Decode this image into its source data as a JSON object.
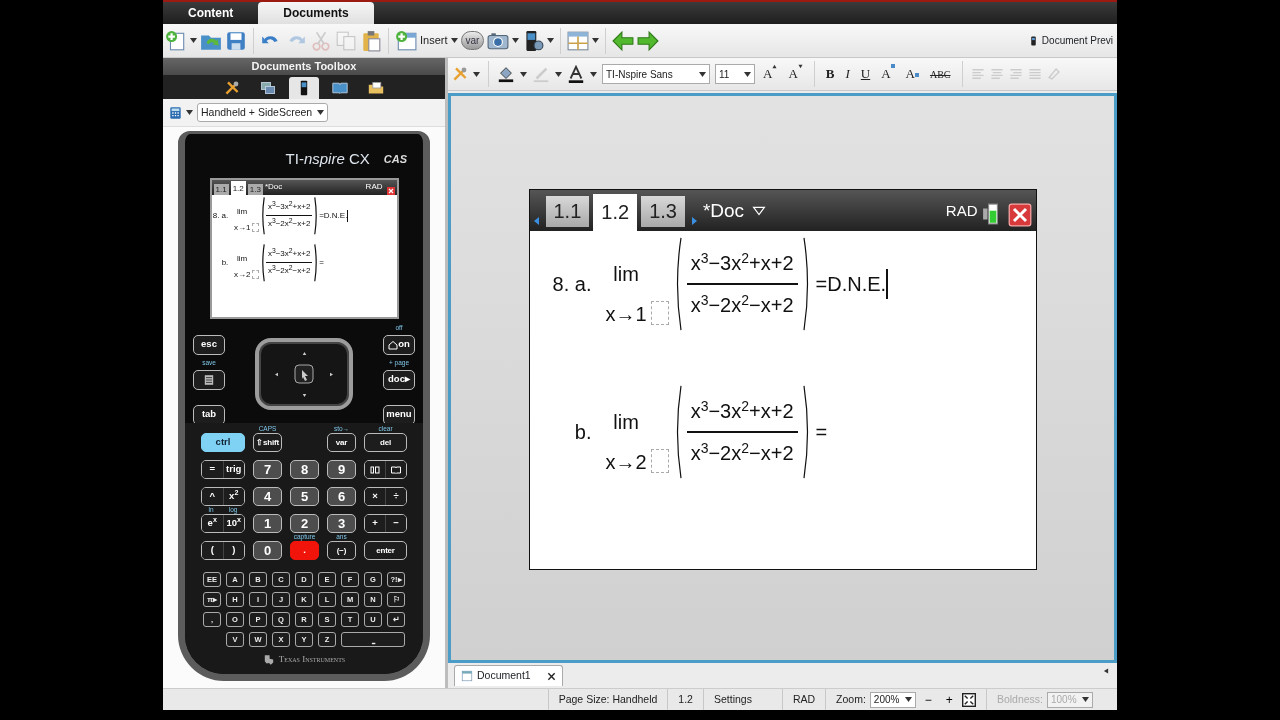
{
  "app_tabs": [
    {
      "label": "Content",
      "selected": false
    },
    {
      "label": "Documents",
      "selected": true
    }
  ],
  "main_toolbar": [
    [
      {
        "kind": "new",
        "disabled": false
      },
      {
        "kind": "caret",
        "disabled": false
      },
      {
        "kind": "open",
        "disabled": false
      },
      {
        "kind": "save",
        "disabled": false
      }
    ],
    [
      {
        "kind": "undo",
        "disabled": false
      },
      {
        "kind": "redo",
        "disabled": true
      },
      {
        "kind": "cut",
        "disabled": true
      },
      {
        "kind": "copy",
        "disabled": true
      },
      {
        "kind": "paste",
        "disabled": false
      }
    ],
    [
      {
        "kind": "insert",
        "label": "Insert",
        "disabled": false
      },
      {
        "kind": "caret",
        "disabled": false
      },
      {
        "kind": "var",
        "label": "var",
        "disabled": false
      },
      {
        "kind": "camera",
        "disabled": false
      },
      {
        "kind": "caret",
        "disabled": false
      },
      {
        "kind": "handheld",
        "disabled": false
      },
      {
        "kind": "caret",
        "disabled": false
      }
    ],
    [
      {
        "kind": "layout",
        "disabled": false
      },
      {
        "kind": "caret",
        "disabled": false
      }
    ],
    [
      {
        "kind": "back",
        "disabled": false
      },
      {
        "kind": "forward",
        "disabled": false
      }
    ]
  ],
  "preview_label": "Document Previ",
  "toolbox": {
    "title": "Documents Toolbox",
    "tabs": [
      {
        "kind": "tools",
        "selected": false
      },
      {
        "kind": "windows",
        "selected": false
      },
      {
        "kind": "handheld",
        "selected": true
      },
      {
        "kind": "book",
        "selected": false
      },
      {
        "kind": "folder",
        "selected": false
      }
    ],
    "view_mode": "Handheld + SideScreen"
  },
  "format_toolbar": {
    "font": "TI-Nspire Sans",
    "size": "11",
    "buttons": [
      {
        "kind": "grow",
        "label": "A"
      },
      {
        "kind": "shrink",
        "label": "A"
      },
      {
        "kind": "bold",
        "label": "B"
      },
      {
        "kind": "italic",
        "label": "I"
      },
      {
        "kind": "underline",
        "label": "U"
      },
      {
        "kind": "superscript",
        "label": "A"
      },
      {
        "kind": "subscript",
        "label": "A"
      },
      {
        "kind": "strike",
        "label": "ABC"
      }
    ]
  },
  "handheld": {
    "brand": "TI-*nspire* CX",
    "edition": "CAS",
    "screen": {
      "tabs": [
        {
          "label": "1.1",
          "selected": false
        },
        {
          "label": "1.2",
          "selected": true
        },
        {
          "label": "1.3",
          "selected": false
        }
      ],
      "doc_name": "*Doc",
      "angle_mode": "RAD",
      "problems": [
        {
          "label": "8. a.",
          "limit": "lim",
          "approach": "x→1",
          "numerator": "x$^{3}$−3x$^{2}$+x+2",
          "denominator": "x$^{3}$−2x$^{2}$−x+2",
          "result": "=D.N.E.",
          "cursor": true
        },
        {
          "label": "b.",
          "limit": "lim",
          "approach": "x→2",
          "numerator": "x$^{3}$−3x$^{2}$+x+2",
          "denominator": "x$^{3}$−2x$^{2}$−x+2",
          "result": "=",
          "cursor": false
        }
      ]
    },
    "nav_left": [
      {
        "kind": "text",
        "label": "esc"
      },
      {
        "kind": "scratchpad",
        "secondary": "save"
      },
      {
        "kind": "text",
        "label": "tab"
      }
    ],
    "nav_right": [
      {
        "kind": "home",
        "label": "on",
        "secondary": "off"
      },
      {
        "kind": "text",
        "label": "doc▸",
        "secondary": "+ page"
      },
      {
        "kind": "text",
        "label": "menu"
      }
    ],
    "keypad_rows": [
      [
        {
          "kind": "ctrl",
          "label": "ctrl"
        },
        {
          "kind": "func",
          "label": "⇧shift",
          "secondary": "CAPS"
        },
        {
          "kind": "blank"
        },
        {
          "kind": "func",
          "label": "var",
          "secondary": "sto→"
        },
        {
          "kind": "func",
          "label": "del",
          "secondary": "clear"
        }
      ],
      [
        {
          "kind": "pair",
          "left": "=",
          "right": "trig"
        },
        {
          "kind": "num",
          "label": "7"
        },
        {
          "kind": "num",
          "label": "8"
        },
        {
          "kind": "num",
          "label": "9"
        },
        {
          "kind": "icon_pair"
        }
      ],
      [
        {
          "kind": "pair",
          "left": "^",
          "right": "x$^{2}$"
        },
        {
          "kind": "num",
          "label": "4"
        },
        {
          "kind": "num",
          "label": "5"
        },
        {
          "kind": "num",
          "label": "6"
        },
        {
          "kind": "pair",
          "left": "×",
          "right": "÷"
        }
      ],
      [
        {
          "kind": "pair",
          "left": "e$^{x}$",
          "right": "10$^{x}$",
          "left_secondary": "ln",
          "right_secondary": "log"
        },
        {
          "kind": "num",
          "label": "1"
        },
        {
          "kind": "num",
          "label": "2"
        },
        {
          "kind": "num",
          "label": "3"
        },
        {
          "kind": "pair",
          "left": "+",
          "right": "−"
        }
      ],
      [
        {
          "kind": "pair",
          "left": "(",
          "right": ")"
        },
        {
          "kind": "num",
          "label": "0"
        },
        {
          "kind": "capture",
          "label": ".",
          "secondary": "capture"
        },
        {
          "kind": "func",
          "label": "(−)",
          "secondary": "ans"
        },
        {
          "kind": "func",
          "label": "enter"
        }
      ]
    ],
    "alpha_rows": [
      [
        "EE",
        "A",
        "B",
        "C",
        "D",
        "E",
        "F",
        "G",
        "?!▸"
      ],
      [
        "π▸",
        "H",
        "I",
        "J",
        "K",
        "L",
        "M",
        "N",
        "⚐"
      ],
      [
        ",",
        "O",
        "P",
        "Q",
        "R",
        "S",
        "T",
        "U",
        "↵"
      ],
      [
        "V",
        "W",
        "X",
        "Y",
        "Z",
        "⎵"
      ]
    ],
    "maker": "Texas Instruments"
  },
  "page": {
    "tabs": [
      {
        "label": "1.1",
        "selected": false
      },
      {
        "label": "1.2",
        "selected": true
      },
      {
        "label": "1.3",
        "selected": false
      }
    ],
    "doc_name": "*Doc",
    "angle_mode": "RAD",
    "problems": [
      {
        "label": "8. a.",
        "limit": "lim",
        "approach": "x→1",
        "numerator": "x$^{3}$−3x$^{2}$+x+2",
        "denominator": "x$^{3}$−2x$^{2}$−x+2",
        "result": "=D.N.E.",
        "cursor": true
      },
      {
        "label": "b.",
        "limit": "lim",
        "approach": "x→2",
        "numerator": "x$^{3}$−3x$^{2}$+x+2",
        "denominator": "x$^{3}$−2x$^{2}$−x+2",
        "result": "=",
        "cursor": false
      }
    ]
  },
  "document_tabs": [
    {
      "label": "Document1",
      "selected": true
    }
  ],
  "status_bar": {
    "page_size": "Page Size: Handheld",
    "page_number": "1.2",
    "settings": "Settings",
    "angle_mode": "RAD",
    "zoom_label": "Zoom:",
    "zoom_value": "200%",
    "zoom_out": "−",
    "zoom_in": "+",
    "boldness_label": "Boldness:",
    "boldness_value": "100%",
    "boldness_disabled": true
  }
}
